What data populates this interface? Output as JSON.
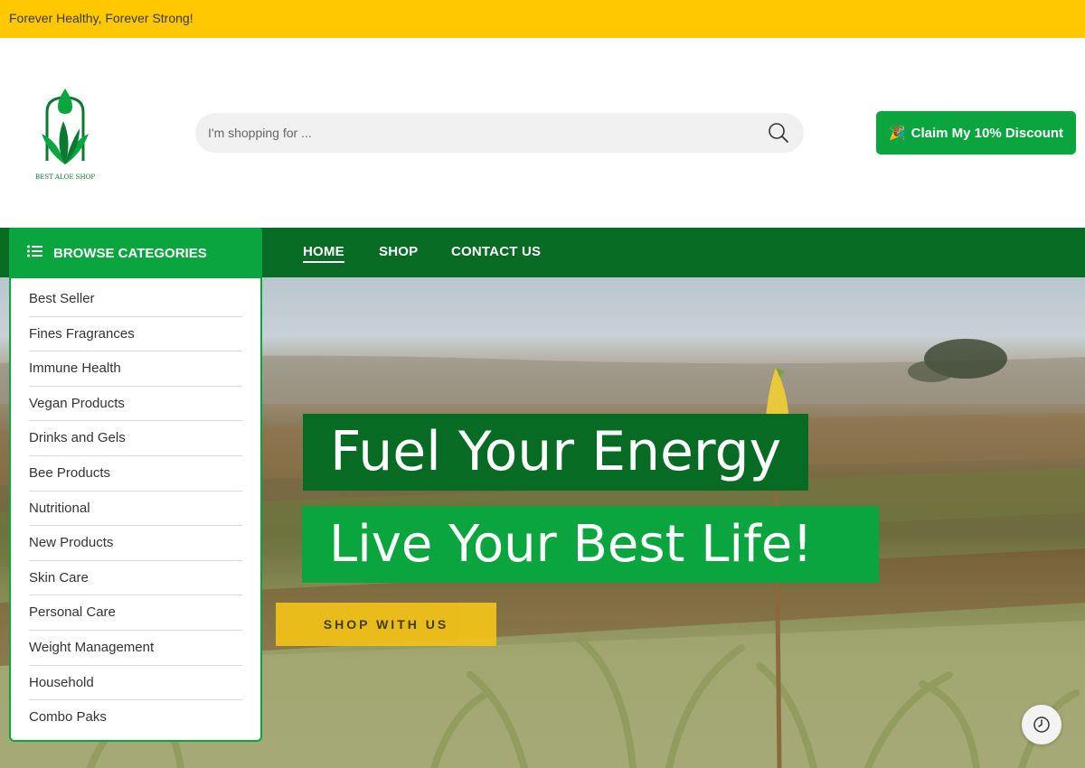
{
  "topbar": {
    "tagline": "Forever Healthy, Forever Strong!"
  },
  "header": {
    "logo_text": "BEST ALOE SHOP",
    "search_placeholder": "I'm shopping for ...",
    "claim_label": "Claim My 10% Discount",
    "claim_icon": "party-popper-icon"
  },
  "categories": {
    "title": "BROWSE CATEGORIES",
    "items": [
      "Best Seller",
      "Fines Fragrances",
      "Immune Health",
      "Vegan Products",
      "Drinks and Gels",
      "Bee Products",
      "Nutritional",
      "New Products",
      "Skin Care",
      "Personal Care",
      "Weight Management",
      "Household",
      "Combo Paks"
    ]
  },
  "nav": {
    "links": [
      {
        "label": "HOME",
        "active": true
      },
      {
        "label": "SHOP",
        "active": false
      },
      {
        "label": "CONTACT US",
        "active": false
      }
    ]
  },
  "hero": {
    "headline1": "Fuel Your Energy",
    "headline2": "Live Your Best Life!",
    "cta_label": "SHOP WITH US"
  },
  "colors": {
    "topbar": "#ffc800",
    "nav": "#076b24",
    "accent_green": "#0ba53f",
    "cta_yellow": "#f2c318"
  }
}
